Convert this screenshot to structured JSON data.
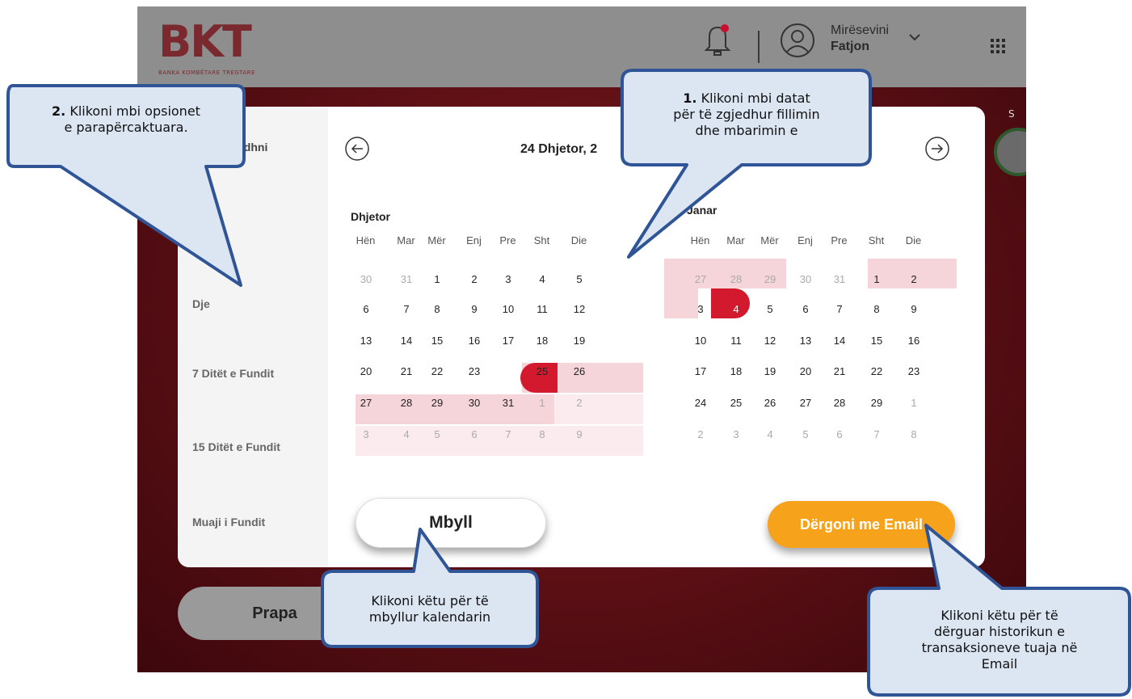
{
  "header": {
    "logo_text": "BKT",
    "logo_tagline": "BANKA KOMBËTARE TREGTARE",
    "greeting": "Mirësevini",
    "user_name": "Fatjon"
  },
  "modal": {
    "sidebar_heading": "ha që zgjidhni",
    "options": [
      "Dje",
      "7 Ditët e Fundit",
      "15 Ditët e Fundit",
      "Muaji i Fundit"
    ],
    "range_title": "24 Dhjetor, 2",
    "months": [
      {
        "name": "Dhjetor",
        "weekdays": [
          "Hën",
          "Mar",
          "Mër",
          "Enj",
          "Pre",
          "Sht",
          "Die"
        ],
        "weeks": [
          [
            "30",
            "31",
            "1",
            "2",
            "3",
            "4",
            "5"
          ],
          [
            "6",
            "7",
            "8",
            "9",
            "10",
            "11",
            "12"
          ],
          [
            "13",
            "14",
            "15",
            "16",
            "17",
            "18",
            "19"
          ],
          [
            "20",
            "21",
            "22",
            "23",
            "24",
            "25",
            "26"
          ],
          [
            "27",
            "28",
            "29",
            "30",
            "31",
            "1",
            "2"
          ],
          [
            "3",
            "4",
            "5",
            "6",
            "7",
            "8",
            "9"
          ]
        ]
      },
      {
        "name": "Janar",
        "weekdays": [
          "Hën",
          "Mar",
          "Mër",
          "Enj",
          "Pre",
          "Sht",
          "Die"
        ],
        "weeks": [
          [
            "27",
            "28",
            "29",
            "30",
            "31",
            "1",
            "2"
          ],
          [
            "3",
            "4",
            "5",
            "6",
            "7",
            "8",
            "9"
          ],
          [
            "10",
            "11",
            "12",
            "13",
            "14",
            "15",
            "16"
          ],
          [
            "17",
            "18",
            "19",
            "20",
            "21",
            "22",
            "23"
          ],
          [
            "24",
            "25",
            "26",
            "27",
            "28",
            "29",
            "1"
          ],
          [
            "2",
            "3",
            "4",
            "5",
            "6",
            "7",
            "8"
          ]
        ]
      }
    ],
    "close_label": "Mbyll",
    "email_label": "Dërgoni me Email"
  },
  "back_label": "Prapa",
  "edge_label": "S",
  "callouts": {
    "c1_num": "1.",
    "c1_text_a": " Klikoni mbi datat",
    "c1_text_b": "për të zgjedhur fillimin",
    "c1_text_c": "dhe mbarimin e",
    "c2_num": "2.",
    "c2_text_a": " Klikoni mbi opsionet",
    "c2_text_b": "e parapërcaktuara.",
    "c3_line1": "Klikoni këtu për të",
    "c3_line2": "mbyllur kalendarin",
    "c4_line1": "Klikoni këtu për të",
    "c4_line2": "dërguar historikun e",
    "c4_line3": "transaksioneve tuaja në",
    "c4_line4": "Email"
  },
  "colors": {
    "brand_red": "#d2192e",
    "range_pink": "#f5d4da",
    "email_orange": "#f7a21b",
    "callout_fill": "#dce6f2",
    "callout_border": "#2f5597"
  }
}
